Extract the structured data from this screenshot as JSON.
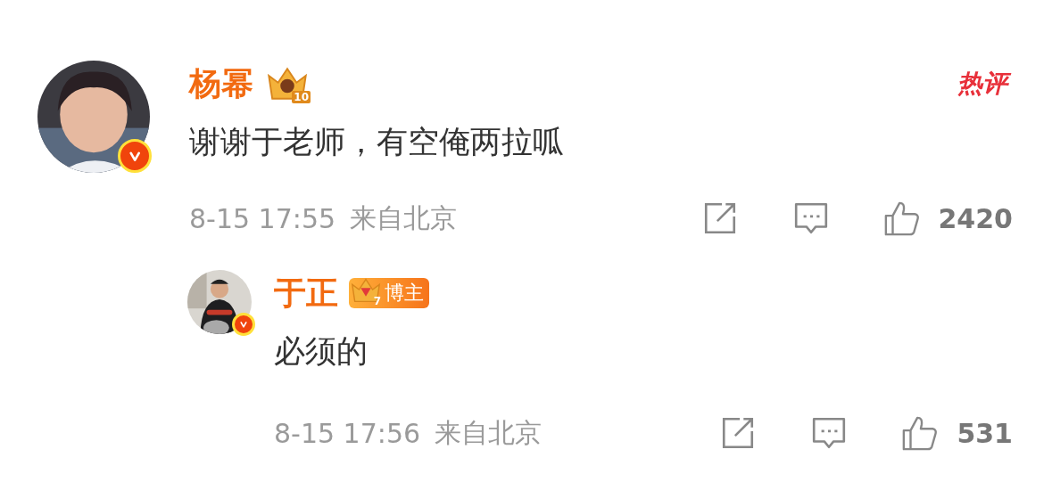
{
  "comment": {
    "author": "杨幂",
    "crown_level": "10",
    "verified": true,
    "hot_tag": "热评",
    "text": "谢谢于老师，有空俺两拉呱",
    "time": "8-15 17:55",
    "location": "来自北京",
    "likes": "2420",
    "reply": {
      "author": "于正",
      "crown_level": "7",
      "role_badge": "博主",
      "verified": true,
      "text": "必须的",
      "time": "8-15 17:56",
      "location": "来自北京",
      "likes": "531"
    }
  }
}
